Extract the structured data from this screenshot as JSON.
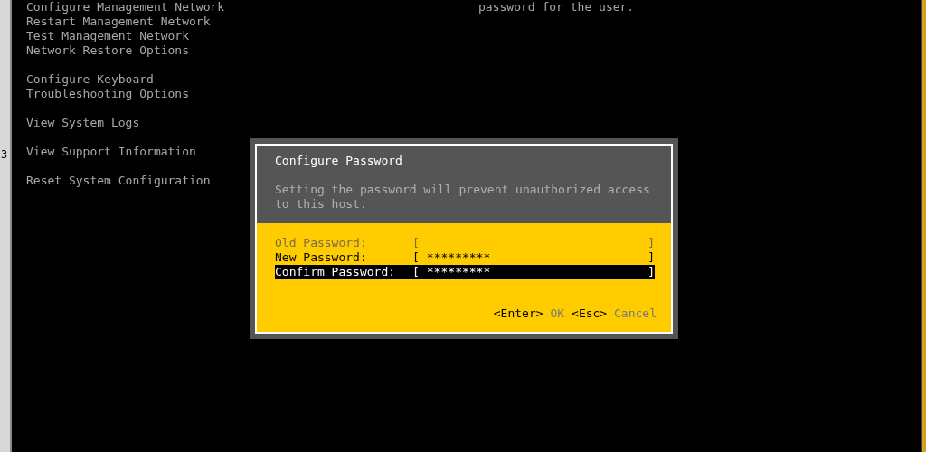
{
  "side_window": {
    "text": "3"
  },
  "menu": {
    "groups": [
      [
        "Configure Management Network",
        "Restart Management Network",
        "Test Management Network",
        "Network Restore Options"
      ],
      [
        "Configure Keyboard",
        "Troubleshooting Options"
      ],
      [
        "View System Logs"
      ],
      [
        "View Support Information"
      ],
      [
        "Reset System Configuration"
      ]
    ]
  },
  "help_text": "password for the user.",
  "dialog": {
    "title": "Configure Password",
    "message": "Setting the password will prevent unauthorized access to this host.",
    "fields": [
      {
        "label": "Old Password:",
        "open": "[",
        "close": "]",
        "disabled": true,
        "selected": false
      },
      {
        "label": "New Password:",
        "open": "[",
        "value": "*********",
        "close": "]",
        "disabled": false,
        "selected": false
      },
      {
        "label": "Confirm Password:",
        "open": "[",
        "value": "*********",
        "cursor": "_",
        "close": "]",
        "disabled": false,
        "selected": true
      }
    ],
    "actions": [
      {
        "key": "<Enter>",
        "label": "OK"
      },
      {
        "key": "<Esc>",
        "label": "Cancel"
      }
    ]
  }
}
